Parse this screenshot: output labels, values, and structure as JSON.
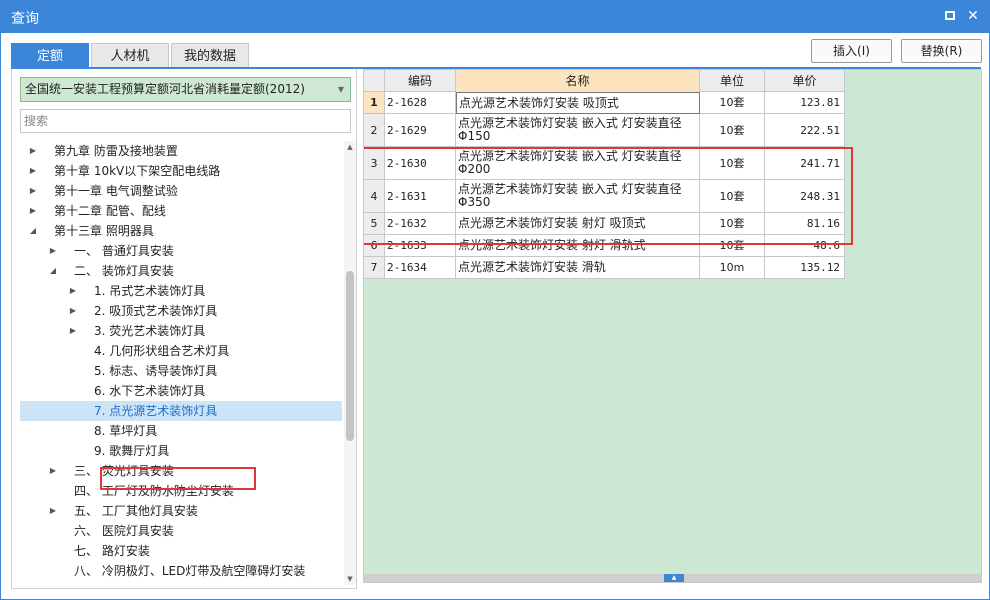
{
  "window": {
    "title": "查询"
  },
  "tabs": [
    {
      "label": "定额"
    },
    {
      "label": "人材机"
    },
    {
      "label": "我的数据"
    }
  ],
  "toolbar": {
    "insert_label": "插入(I)",
    "replace_label": "替换(R)"
  },
  "left": {
    "library_select": "全国统一安装工程预算定额河北省消耗量定额(2012)",
    "search_placeholder": "搜索",
    "tree": [
      {
        "label": "第九章 防雷及接地装置",
        "level": 0,
        "arrow": "collapsed"
      },
      {
        "label": "第十章 10kV以下架空配电线路",
        "level": 0,
        "arrow": "collapsed"
      },
      {
        "label": "第十一章 电气调整试验",
        "level": 0,
        "arrow": "collapsed"
      },
      {
        "label": "第十二章 配管、配线",
        "level": 0,
        "arrow": "collapsed"
      },
      {
        "label": "第十三章 照明器具",
        "level": 0,
        "arrow": "expanded"
      },
      {
        "label": "一、 普通灯具安装",
        "level": 1,
        "arrow": "collapsed"
      },
      {
        "label": "二、 装饰灯具安装",
        "level": 1,
        "arrow": "expanded"
      },
      {
        "label": "1. 吊式艺术装饰灯具",
        "level": 2,
        "arrow": "collapsed"
      },
      {
        "label": "2. 吸顶式艺术装饰灯具",
        "level": 2,
        "arrow": "collapsed"
      },
      {
        "label": "3. 荧光艺术装饰灯具",
        "level": 2,
        "arrow": "collapsed"
      },
      {
        "label": "4. 几何形状组合艺术灯具",
        "level": 2,
        "arrow": "none"
      },
      {
        "label": "5. 标志、诱导装饰灯具",
        "level": 2,
        "arrow": "none"
      },
      {
        "label": "6. 水下艺术装饰灯具",
        "level": 2,
        "arrow": "none"
      },
      {
        "label": "7. 点光源艺术装饰灯具",
        "level": 2,
        "arrow": "none",
        "selected": true
      },
      {
        "label": "8. 草坪灯具",
        "level": 2,
        "arrow": "none"
      },
      {
        "label": "9. 歌舞厅灯具",
        "level": 2,
        "arrow": "none"
      },
      {
        "label": "三、 荧光灯具安装",
        "level": 1,
        "arrow": "collapsed"
      },
      {
        "label": "四、 工厂灯及防水防尘灯安装",
        "level": 1,
        "arrow": "none"
      },
      {
        "label": "五、 工厂其他灯具安装",
        "level": 1,
        "arrow": "collapsed"
      },
      {
        "label": "六、 医院灯具安装",
        "level": 1,
        "arrow": "none"
      },
      {
        "label": "七、 路灯安装",
        "level": 1,
        "arrow": "none"
      },
      {
        "label": "八、 冷阴极灯、LED灯带及航空障碍灯安装",
        "level": 1,
        "arrow": "none"
      }
    ]
  },
  "grid": {
    "columns": [
      "",
      "编码",
      "名称",
      "单位",
      "单价"
    ],
    "rows": [
      {
        "no": "1",
        "code": "2-1628",
        "name": "点光源艺术装饰灯安装 吸顶式",
        "unit": "10套",
        "price": "123.81",
        "current": true
      },
      {
        "no": "2",
        "code": "2-1629",
        "name": "点光源艺术装饰灯安装 嵌入式 灯安装直径Φ150",
        "unit": "10套",
        "price": "222.51"
      },
      {
        "no": "3",
        "code": "2-1630",
        "name": "点光源艺术装饰灯安装 嵌入式 灯安装直径Φ200",
        "unit": "10套",
        "price": "241.71"
      },
      {
        "no": "4",
        "code": "2-1631",
        "name": "点光源艺术装饰灯安装 嵌入式 灯安装直径Φ350",
        "unit": "10套",
        "price": "248.31"
      },
      {
        "no": "5",
        "code": "2-1632",
        "name": "点光源艺术装饰灯安装 射灯 吸顶式",
        "unit": "10套",
        "price": "81.16"
      },
      {
        "no": "6",
        "code": "2-1633",
        "name": "点光源艺术装饰灯安装 射灯 滑轨式",
        "unit": "10套",
        "price": "48.6"
      },
      {
        "no": "7",
        "code": "2-1634",
        "name": "点光源艺术装饰灯安装 滑轨",
        "unit": "10m",
        "price": "135.12"
      }
    ]
  },
  "colors": {
    "accent": "#3b86d9",
    "highlight": "#e0363a",
    "grid_bg": "#cce7d2"
  }
}
